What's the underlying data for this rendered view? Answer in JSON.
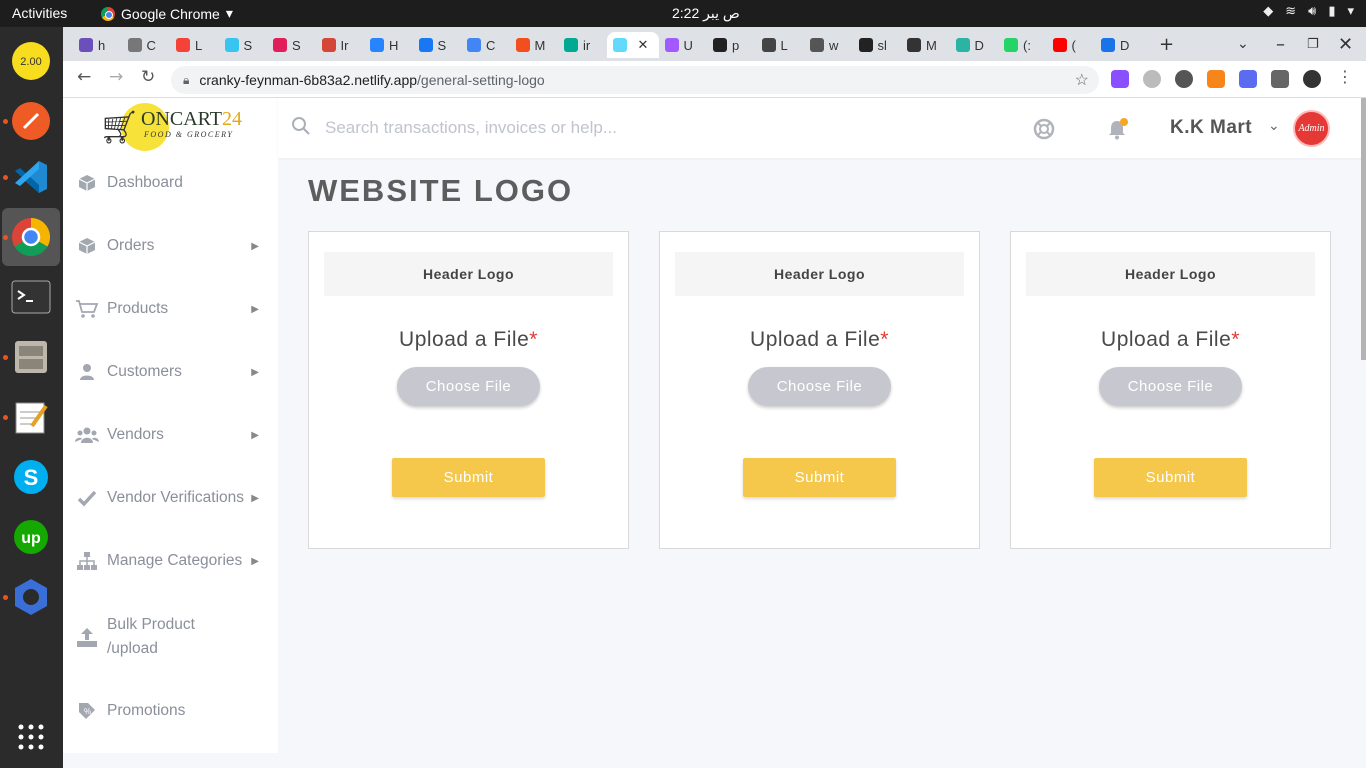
{
  "os": {
    "activities": "Activities",
    "app_name": "Google Chrome",
    "clock": "2:22 ص يبر"
  },
  "browser": {
    "tabs": [
      {
        "label": "h",
        "color": "#6b4fbb"
      },
      {
        "label": "C",
        "color": "#777777"
      },
      {
        "label": "L",
        "color": "#f44336"
      },
      {
        "label": "S",
        "color": "#36c5f0"
      },
      {
        "label": "S",
        "color": "#e01e5a"
      },
      {
        "label": "Ir",
        "color": "#d44638"
      },
      {
        "label": "H",
        "color": "#2684ff"
      },
      {
        "label": "S",
        "color": "#1877f2"
      },
      {
        "label": "C",
        "color": "#4285f4"
      },
      {
        "label": "M",
        "color": "#f24e1e"
      },
      {
        "label": "ir",
        "color": "#00a98f"
      },
      {
        "label": "",
        "color": "#61dafb",
        "active": true
      },
      {
        "label": "U",
        "color": "#a259ff"
      },
      {
        "label": "p",
        "color": "#222222"
      },
      {
        "label": "L",
        "color": "#444444"
      },
      {
        "label": "w",
        "color": "#555555"
      },
      {
        "label": "sl",
        "color": "#222222"
      },
      {
        "label": "M",
        "color": "#333333"
      },
      {
        "label": "D",
        "color": "#2bb3a3"
      },
      {
        "label": "(:",
        "color": "#25d366"
      },
      {
        "label": "(",
        "color": "#ff0000"
      },
      {
        "label": "D",
        "color": "#1a73e8"
      }
    ],
    "url_host": "cranky-feynman-6b83a2.netlify.app",
    "url_path": "/general-setting-logo"
  },
  "sidebar": {
    "logo_brand": "ONCART",
    "logo_num": "24",
    "logo_tagline": "FOOD & GROCERY",
    "items": [
      {
        "label": "Dashboard",
        "icon": "box-icon",
        "arrow": false
      },
      {
        "label": "Orders",
        "icon": "box-icon",
        "arrow": true
      },
      {
        "label": "Products",
        "icon": "cart-icon",
        "arrow": true
      },
      {
        "label": "Customers",
        "icon": "user-icon",
        "arrow": true
      },
      {
        "label": "Vendors",
        "icon": "users-icon",
        "arrow": true
      },
      {
        "label": "Vendor Verifications",
        "icon": "check-icon",
        "arrow": true
      },
      {
        "label": "Manage Categories",
        "icon": "sitemap-icon",
        "arrow": true
      },
      {
        "label": "Bulk Product\n/upload",
        "icon": "upload-icon",
        "arrow": false
      },
      {
        "label": "Promotions",
        "icon": "percent-tag-icon",
        "arrow": false
      }
    ]
  },
  "header": {
    "search_placeholder": "Search transactions, invoices or help...",
    "store_name": "K.K Mart",
    "avatar_text": "Admin"
  },
  "main": {
    "title": "WEBSITE LOGO",
    "cards": [
      {
        "heading": "Header Logo",
        "upload_label": "Upload a File",
        "required_mark": "*",
        "choose_label": "Choose File",
        "submit_label": "Submit"
      },
      {
        "heading": "Header Logo",
        "upload_label": "Upload a File",
        "required_mark": "*",
        "choose_label": "Choose File",
        "submit_label": "Submit"
      },
      {
        "heading": "Header Logo",
        "upload_label": "Upload a File",
        "required_mark": "*",
        "choose_label": "Choose File",
        "submit_label": "Submit"
      }
    ]
  },
  "colors": {
    "accent_yellow": "#f5c84b",
    "choose_gray": "#c7c7cf",
    "required_red": "#e53935"
  }
}
